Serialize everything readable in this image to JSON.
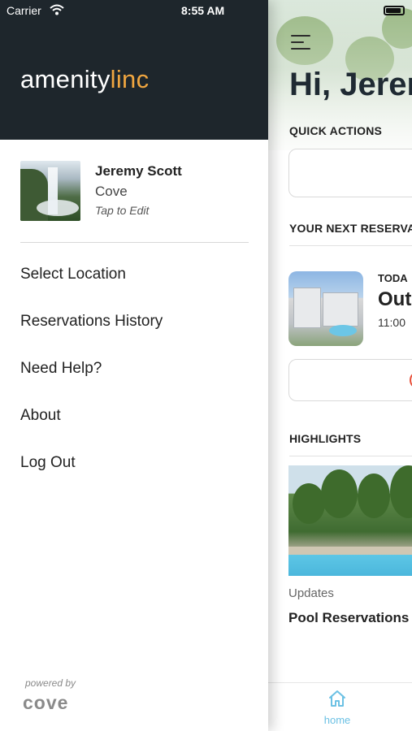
{
  "status_bar": {
    "carrier": "Carrier",
    "time": "8:55 AM"
  },
  "drawer": {
    "logo": {
      "part1": "amenity",
      "part2": "linc"
    },
    "profile": {
      "name": "Jeremy Scott",
      "location": "Cove",
      "edit_hint": "Tap to Edit"
    },
    "menu": [
      {
        "label": "Select Location"
      },
      {
        "label": "Reservations History"
      },
      {
        "label": "Need Help?"
      },
      {
        "label": "About"
      },
      {
        "label": "Log Out"
      }
    ],
    "footer": {
      "powered_by": "powered by",
      "brand": "cove"
    }
  },
  "main": {
    "greeting": "Hi, Jerem",
    "quick_actions_label": "QUICK ACTIONS",
    "next_reservation_label": "YOUR NEXT RESERVA",
    "reservation": {
      "day": "TODA",
      "title": "Out",
      "time": "11:00"
    },
    "highlights_label": "HIGHLIGHTS",
    "highlight": {
      "category": "Updates",
      "title": "Pool Reservations"
    },
    "tabbar": {
      "home_label": "home"
    }
  },
  "colors": {
    "drawer_header": "#1e262c",
    "accent_orange": "#f0a640",
    "tab_active": "#6cc1e4"
  }
}
